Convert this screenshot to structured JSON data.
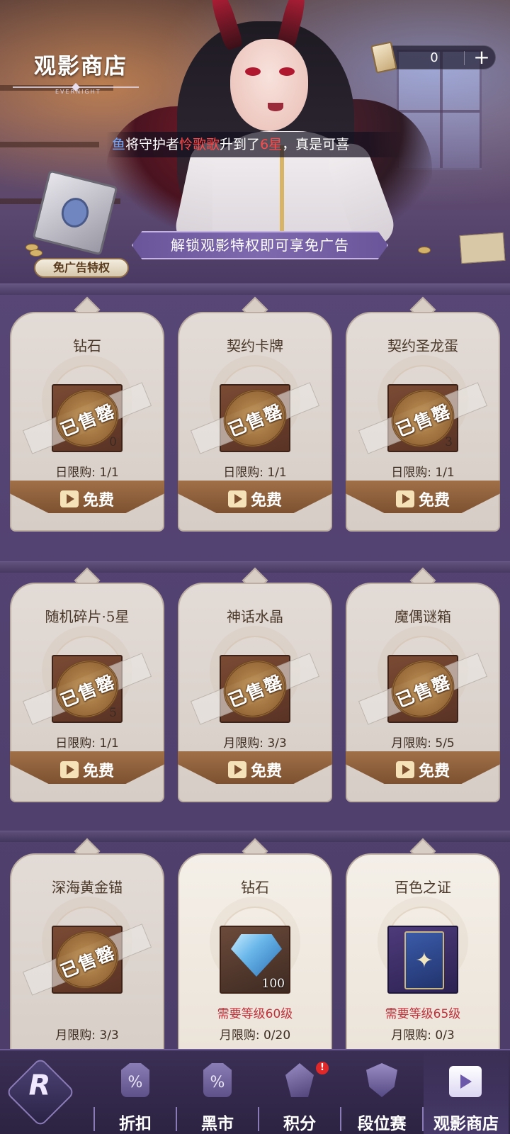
{
  "header": {
    "title": "观影商店",
    "subtitle": "EVERNIGHT",
    "ticket_count": "0",
    "plus_label": "+",
    "notice": {
      "prefix": "鱼",
      "part1": "将守护者",
      "name": "怜歌歌",
      "part2": "升到了",
      "level": "6星",
      "part3": "，真是可喜"
    },
    "privilege_label": "免广告特权",
    "unlock_text": "解锁观影特权即可享免广告"
  },
  "items": [
    {
      "name": "钻石",
      "status": "已售罄",
      "limit": "日限购: 1/1",
      "action": "免费",
      "qty": "0"
    },
    {
      "name": "契约卡牌",
      "status": "已售罄",
      "limit": "日限购: 1/1",
      "action": "免费",
      "qty": ""
    },
    {
      "name": "契约圣龙蛋",
      "status": "已售罄",
      "limit": "日限购: 1/1",
      "action": "免费",
      "qty": "3"
    },
    {
      "name": "随机碎片·5星",
      "status": "已售罄",
      "limit": "日限购: 1/1",
      "action": "免费",
      "qty": "5"
    },
    {
      "name": "神话水晶",
      "status": "已售罄",
      "limit": "月限购: 3/3",
      "action": "免费",
      "qty": ""
    },
    {
      "name": "魔偶谜箱",
      "status": "已售罄",
      "limit": "月限购: 5/5",
      "action": "免费",
      "qty": ""
    },
    {
      "name": "深海黄金锚",
      "status": "已售罄",
      "limit": "月限购: 3/3",
      "action": "",
      "qty": ""
    },
    {
      "name": "钻石",
      "status": "",
      "requirement": "需要等级60级",
      "limit": "月限购: 0/20",
      "qty": "100"
    },
    {
      "name": "百色之证",
      "status": "",
      "requirement": "需要等级65级",
      "limit": "月限购: 0/3",
      "qty": ""
    }
  ],
  "nav": {
    "logo": "R",
    "tabs": [
      {
        "label": "折扣",
        "icon": "discount-tag-icon",
        "glyph": "%"
      },
      {
        "label": "黑市",
        "icon": "black-market-tag-icon",
        "glyph": "%"
      },
      {
        "label": "积分",
        "icon": "crystal-icon",
        "glyph": ""
      },
      {
        "label": "段位赛",
        "icon": "rank-shield-icon",
        "glyph": ""
      },
      {
        "label": "观影商店",
        "icon": "video-camera-icon",
        "glyph": ""
      }
    ],
    "badge": "!",
    "active": "观影商店"
  },
  "colors": {
    "background": "#4a3a63",
    "accent_red": "#c0303a",
    "button_brown": "#8a5c38",
    "unlock_banner": "#7a64aa"
  }
}
